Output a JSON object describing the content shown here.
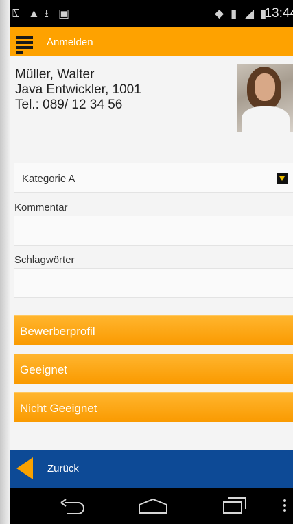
{
  "status_bar": {
    "time": "13:44",
    "icons": [
      "usb-icon",
      "alert-icon",
      "download-icon",
      "clipboard-icon",
      "wifi-icon",
      "battery-warning-icon",
      "signal-icon",
      "battery-icon"
    ]
  },
  "app_bar": {
    "title": "Anmelden",
    "menu_icon": "hamburger-menu-icon"
  },
  "contact": {
    "name": "Müller, Walter",
    "position": "Java Entwickler, 1001",
    "phone": "Tel.: 089/ 12 34 56"
  },
  "form": {
    "category_value": "Kategorie A",
    "comment_label": "Kommentar",
    "comment_value": "",
    "keywords_label": "Schlagwörter",
    "keywords_value": ""
  },
  "actions": {
    "profile": "Bewerberprofil",
    "suitable": "Geeignet",
    "not_suitable": "Nicht Geeignet"
  },
  "back_bar": {
    "label": "Zurück"
  },
  "navigation": [
    "back-icon",
    "home-icon",
    "recent-apps-icon",
    "overflow-menu-icon"
  ],
  "colors": {
    "accent_orange": "#fea200",
    "back_bar_blue": "#0d4a96"
  }
}
